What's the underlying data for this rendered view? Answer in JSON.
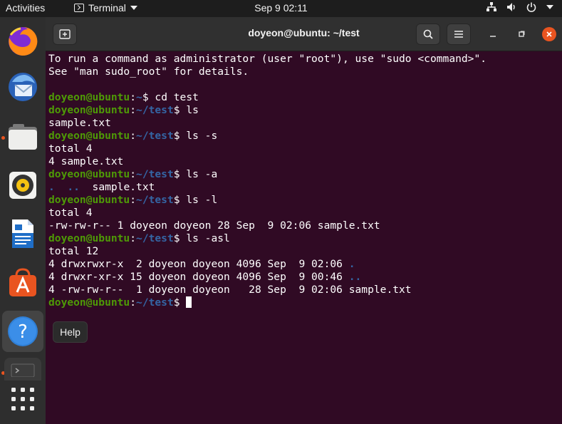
{
  "topbar": {
    "activities": "Activities",
    "app_name": "Terminal",
    "clock": "Sep 9  02:11"
  },
  "dock": {
    "items": [
      "firefox-icon",
      "thunderbird-icon",
      "files-icon",
      "rhythmbox-icon",
      "libreoffice-writer-icon",
      "ubuntu-software-icon",
      "help-icon",
      "terminal-icon",
      "show-apps-icon"
    ]
  },
  "window": {
    "title": "doyeon@ubuntu: ~/test"
  },
  "terminal": {
    "user_host": "doyeon@ubuntu",
    "lines": [
      {
        "type": "text",
        "text": "To run a command as administrator (user \"root\"), use \"sudo <command>\"."
      },
      {
        "type": "text",
        "text": "See \"man sudo_root\" for details."
      },
      {
        "type": "text",
        "text": ""
      },
      {
        "type": "prompt",
        "path": "~",
        "cmd": "cd test"
      },
      {
        "type": "prompt",
        "path": "~/test",
        "cmd": "ls"
      },
      {
        "type": "text",
        "text": "sample.txt"
      },
      {
        "type": "prompt",
        "path": "~/test",
        "cmd": "ls -s"
      },
      {
        "type": "text",
        "text": "total 4"
      },
      {
        "type": "text",
        "text": "4 sample.txt"
      },
      {
        "type": "prompt",
        "path": "~/test",
        "cmd": "ls -a"
      },
      {
        "type": "dirs",
        "dirs": [
          ".",
          ".."
        ],
        "rest": "  sample.txt"
      },
      {
        "type": "prompt",
        "path": "~/test",
        "cmd": "ls -l"
      },
      {
        "type": "text",
        "text": "total 4"
      },
      {
        "type": "text",
        "text": "-rw-rw-r-- 1 doyeon doyeon 28 Sep  9 02:06 sample.txt"
      },
      {
        "type": "prompt",
        "path": "~/test",
        "cmd": "ls -asl"
      },
      {
        "type": "text",
        "text": "total 12"
      },
      {
        "type": "longdir",
        "text": "4 drwxrwxr-x  2 doyeon doyeon 4096 Sep  9 02:06 ",
        "dir": "."
      },
      {
        "type": "longdir",
        "text": "4 drwxr-xr-x 15 doyeon doyeon 4096 Sep  9 00:46 ",
        "dir": ".."
      },
      {
        "type": "text",
        "text": "4 -rw-rw-r--  1 doyeon doyeon   28 Sep  9 02:06 sample.txt"
      },
      {
        "type": "prompt",
        "path": "~/test",
        "cmd": "",
        "cursor": true
      }
    ]
  },
  "tooltip": {
    "label": "Help"
  },
  "colors": {
    "terminal_bg": "#300a24",
    "user_green": "#4e9a06",
    "path_blue": "#3465a4",
    "accent": "#e95420"
  }
}
